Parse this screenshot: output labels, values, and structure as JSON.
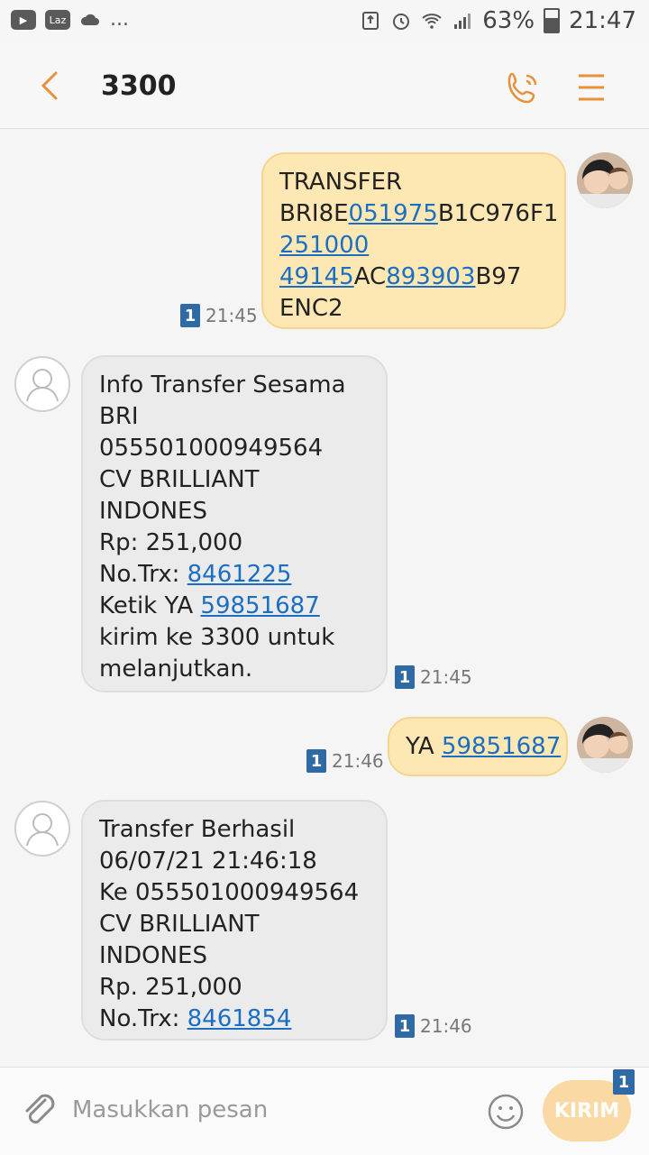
{
  "statusbar": {
    "battery_percent": "63%",
    "time": "21:47",
    "app_icon_label": "Laz",
    "overflow": "..."
  },
  "header": {
    "title": "3300",
    "back_icon": "chevron-left-icon",
    "call_icon": "phone-icon",
    "menu_icon": "menu-icon",
    "accent_color": "#e8903a"
  },
  "messages": [
    {
      "direction": "outgoing",
      "time": "21:45",
      "sim": "1",
      "lines": [
        [
          {
            "text": "TRANSFER"
          }
        ],
        [
          {
            "text": "BRI8E"
          },
          {
            "text": "051975",
            "link": true
          },
          {
            "text": "B1C976F1"
          }
        ],
        [
          {
            "text": "251000",
            "link": true
          }
        ],
        [
          {
            "text": "49145",
            "link": true
          },
          {
            "text": "AC"
          },
          {
            "text": "893903",
            "link": true
          },
          {
            "text": "B97"
          }
        ],
        [
          {
            "text": "ENC2"
          }
        ]
      ]
    },
    {
      "direction": "incoming",
      "time": "21:45",
      "sim": "1",
      "lines": [
        [
          {
            "text": "Info Transfer Sesama"
          }
        ],
        [
          {
            "text": "BRI"
          }
        ],
        [
          {
            "text": "055501000949564"
          }
        ],
        [
          {
            "text": "CV BRILLIANT"
          }
        ],
        [
          {
            "text": "INDONES"
          }
        ],
        [
          {
            "text": "Rp: 251,000"
          }
        ],
        [
          {
            "text": "No.Trx: "
          },
          {
            "text": "8461225",
            "link": true
          }
        ],
        [
          {
            "text": "Ketik YA "
          },
          {
            "text": "59851687",
            "link": true
          }
        ],
        [
          {
            "text": "kirim ke 3300 untuk"
          }
        ],
        [
          {
            "text": "melanjutkan."
          }
        ]
      ]
    },
    {
      "direction": "outgoing",
      "time": "21:46",
      "sim": "1",
      "lines": [
        [
          {
            "text": "YA "
          },
          {
            "text": "59851687",
            "link": true
          }
        ]
      ]
    },
    {
      "direction": "incoming",
      "time": "21:46",
      "sim": "1",
      "lines": [
        [
          {
            "text": "Transfer Berhasil"
          }
        ],
        [
          {
            "text": "06/07/21 21:46:18"
          }
        ],
        [
          {
            "text": "Ke 055501000949564"
          }
        ],
        [
          {
            "text": "CV BRILLIANT"
          }
        ],
        [
          {
            "text": "INDONES"
          }
        ],
        [
          {
            "text": "Rp. 251,000"
          }
        ],
        [
          {
            "text": "No.Trx: "
          },
          {
            "text": "8461854",
            "link": true
          }
        ]
      ]
    }
  ],
  "composer": {
    "placeholder": "Masukkan pesan",
    "send_label": "KIRIM",
    "send_sim": "1",
    "attach_icon": "paperclip-icon",
    "emoji_icon": "smiley-icon"
  }
}
